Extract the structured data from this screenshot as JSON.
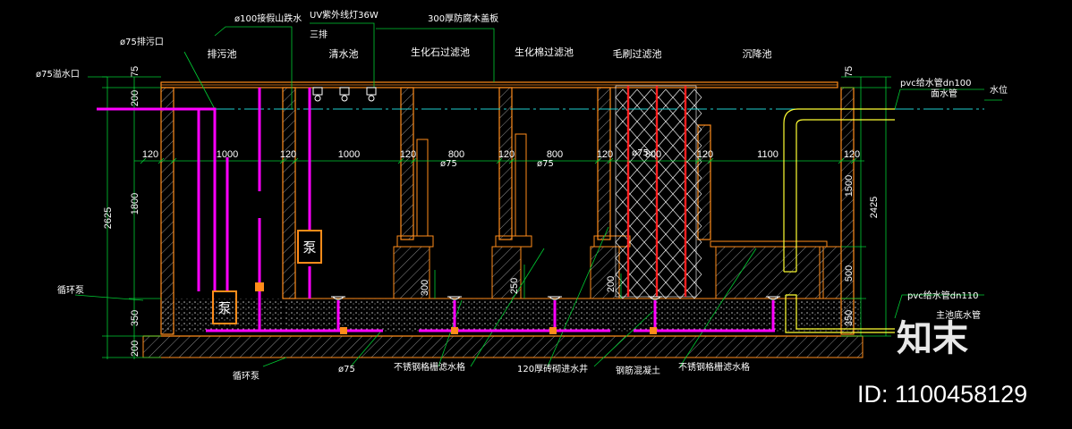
{
  "labels": {
    "pipe_100_overflow": "ø100接假山跌水",
    "uv_lamp": "UV紫外线灯36W",
    "three_lamps": "三排",
    "cover_board": "300厚防腐木盖板",
    "sewage_outlet": "ø75排污口",
    "overflow_port": "ø75溢水口",
    "pvc_in_dn100": "pvc给水管dn100",
    "surface_water": "面水管",
    "water_level": "水位",
    "circulation_pump_label": "循环泵",
    "pump_char": "泵",
    "pvc_in_dn110": "pvc给水管dn110",
    "main_drain": "主池底水管",
    "pipe_75_bottom": "ø75",
    "steel_grate_1": "不锈钢格栅滤水格",
    "brick_120": "120厚砖砌进水井",
    "rc_concrete": "钢筋混凝土",
    "steel_grate_2": "不锈钢格栅滤水格",
    "discharge_pump": "循环泵",
    "pipe_d75_a": "ø75",
    "pipe_d75_b": "ø75",
    "pipe_d75_c": "ø75"
  },
  "chambers": [
    {
      "name": "排污池"
    },
    {
      "name": "清水池"
    },
    {
      "name": "生化石过滤池"
    },
    {
      "name": "生化棉过滤池"
    },
    {
      "name": "毛刷过滤池"
    },
    {
      "name": "沉降池"
    }
  ],
  "dims_horizontal": [
    "120",
    "1000",
    "120",
    "1000",
    "120",
    "800",
    "120",
    "800",
    "120",
    "800",
    "120",
    "1100",
    "120"
  ],
  "dims_left": [
    "75",
    "200",
    "1800",
    "350",
    "200",
    "2625"
  ],
  "dims_right": [
    "75",
    "1500",
    "500",
    "350",
    "2425"
  ],
  "dims_small": [
    "300",
    "250",
    "200"
  ],
  "watermark": {
    "brand": "知末",
    "id": "ID: 1100458129"
  },
  "colors": {
    "wall": "#ff8c1a",
    "pipe": "#ff00ff",
    "dim": "#00cc33",
    "brush": "#ff2020",
    "waterline": "#20d0d0",
    "hatch": "#808080",
    "yellow_pipe": "#ffff33"
  }
}
